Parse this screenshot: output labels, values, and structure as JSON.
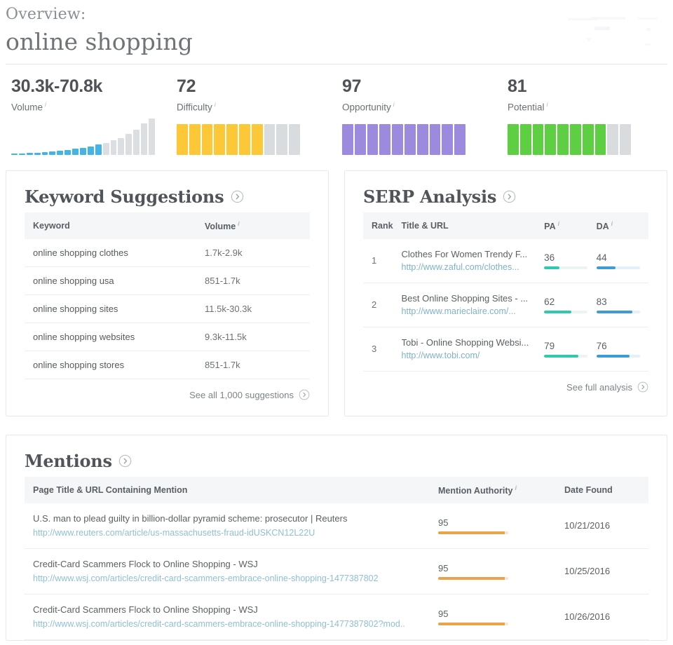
{
  "header": {
    "overview_label": "Overview:",
    "keyword": "online shopping"
  },
  "metrics": [
    {
      "value": "30.3k-70.8k",
      "label": "Volume",
      "info_icon": "info-icon",
      "viz": "sparkline",
      "color": "#44b4e5",
      "off_color": "#d8dcde",
      "spark_active": [
        3,
        3,
        5,
        5,
        7,
        8,
        10,
        12,
        15,
        18,
        22,
        26
      ],
      "spark_inactive": [
        30,
        38,
        44,
        54,
        66,
        82,
        96
      ]
    },
    {
      "value": "72",
      "label": "Difficulty",
      "info_icon": "info-icon",
      "viz": "segments",
      "color": "#fcc838",
      "off_color": "#d8dcde",
      "segments_total": 10,
      "segments_filled": 7
    },
    {
      "value": "97",
      "label": "Opportunity",
      "info_icon": "info-icon",
      "viz": "segments",
      "color": "#9b8ade",
      "off_color": "#d8dcde",
      "segments_total": 10,
      "segments_filled": 10
    },
    {
      "value": "81",
      "label": "Potential",
      "info_icon": "info-icon",
      "viz": "segments",
      "color": "#5ece43",
      "off_color": "#d8dcde",
      "segments_total": 10,
      "segments_filled": 8
    }
  ],
  "keyword_suggestions": {
    "title": "Keyword Suggestions",
    "chevron_icon": "chevron-right-circle-icon",
    "columns": [
      "Keyword",
      "Volume"
    ],
    "volume_info_icon": "info-icon",
    "rows": [
      {
        "keyword": "online shopping clothes",
        "volume": "1.7k-2.9k"
      },
      {
        "keyword": "online shopping usa",
        "volume": "851-1.7k"
      },
      {
        "keyword": "online shopping sites",
        "volume": "11.5k-30.3k"
      },
      {
        "keyword": "online shopping websites",
        "volume": "9.3k-11.5k"
      },
      {
        "keyword": "online shopping stores",
        "volume": "851-1.7k"
      }
    ],
    "footer_link": "See all 1,000 suggestions",
    "footer_icon": "chevron-right-circle-icon"
  },
  "serp_analysis": {
    "title": "SERP Analysis",
    "chevron_icon": "chevron-right-circle-icon",
    "columns": [
      "Rank",
      "Title & URL",
      "PA",
      "DA"
    ],
    "pa_info_icon": "info-icon",
    "da_info_icon": "info-icon",
    "pa_color": "#2ec9ae",
    "da_color": "#3d9bd6",
    "rows": [
      {
        "rank": "1",
        "title": "Clothes For Women Trendy F...",
        "url": "http://www.zaful.com/clothes...",
        "pa": "36",
        "da": "44"
      },
      {
        "rank": "2",
        "title": "Best Online Shopping Sites - ...",
        "url": "http://www.marieclaire.com/...",
        "pa": "62",
        "da": "83"
      },
      {
        "rank": "3",
        "title": "Tobi - Online Shopping Websi...",
        "url": "http://www.tobi.com/",
        "pa": "79",
        "da": "76"
      }
    ],
    "footer_link": "See full analysis",
    "footer_icon": "chevron-right-circle-icon"
  },
  "mentions": {
    "title": "Mentions",
    "chevron_icon": "chevron-right-circle-icon",
    "columns": [
      "Page Title & URL Containing Mention",
      "Mention Authority",
      "Date Found"
    ],
    "authority_info_icon": "info-icon",
    "authority_color": "#e8a council",
    "rows": [
      {
        "title": "U.S. man to plead guilty in billion-dollar pyramid scheme: prosecutor | Reuters",
        "url": "http://www.reuters.com/article/us-massachusetts-fraud-idUSKCN12L22U",
        "authority": "95",
        "date": "10/21/2016"
      },
      {
        "title": "Credit-Card Scammers Flock to Online Shopping - WSJ",
        "url": "http://www.wsj.com/articles/credit-card-scammers-embrace-online-shopping-1477387802",
        "authority": "95",
        "date": "10/25/2016"
      },
      {
        "title": "Credit-Card Scammers Flock to Online Shopping - WSJ",
        "url": "http://www.wsj.com/articles/credit-card-scammers-embrace-online-shopping-1477387802?mod..",
        "authority": "95",
        "date": "10/26/2016"
      }
    ]
  }
}
